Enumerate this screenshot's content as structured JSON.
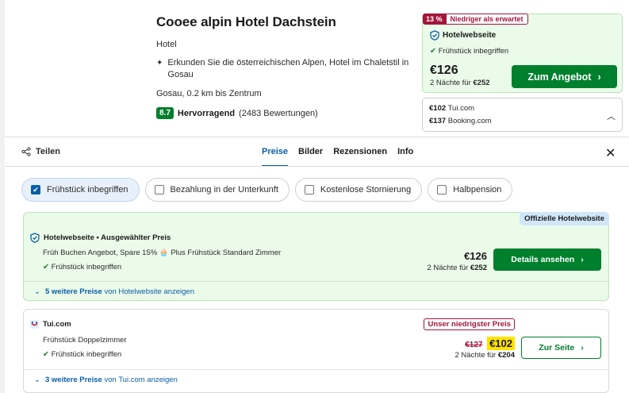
{
  "hotel": {
    "name": "Cooee alpin Hotel Dachstein",
    "type": "Hotel",
    "description": "Erkunden Sie die österreichischen Alpen, Hotel im Chaletstil in Gosau",
    "distance": "Gosau, 0.2 km bis Zentrum",
    "score": "8.7",
    "rating_label": "Hervorragend",
    "rating_count": "(2483 Bewertungen)"
  },
  "top_offer": {
    "discount": "13 %",
    "discount_text": "Niedriger als erwartet",
    "site": "Hotelwebseite",
    "breakfast": "Frühstück inbegriffen",
    "price": "€126",
    "nights_prefix": "2 Nächte für",
    "nights_total": "€252",
    "button": "Zum Angebot"
  },
  "alternatives": [
    {
      "price": "€102",
      "site": "Tui.com"
    },
    {
      "price": "€137",
      "site": "Booking.com"
    }
  ],
  "share_label": "Teilen",
  "tabs": [
    {
      "label": "Preise",
      "active": true
    },
    {
      "label": "Bilder",
      "active": false
    },
    {
      "label": "Rezensionen",
      "active": false
    },
    {
      "label": "Info",
      "active": false
    }
  ],
  "filters": [
    {
      "label": "Frühstück inbegriffen",
      "checked": true
    },
    {
      "label": "Bezahlung in der Unterkunft",
      "checked": false
    },
    {
      "label": "Kostenlose Stornierung",
      "checked": false
    },
    {
      "label": "Halbpension",
      "checked": false
    }
  ],
  "deals": [
    {
      "tag": "Offizielle Hotelwebsite",
      "title": "Hotelwebseite • Ausgewählter Preis",
      "line": "Früh Buchen Angebot, Spare 15%",
      "line_extra": "Plus Frühstück Standard Zimmer",
      "breakfast": "Frühstück inbegriffen",
      "price": "€126",
      "nights_prefix": "2 Nächte für",
      "nights_total": "€252",
      "button": "Details ansehen",
      "more_count": "5 weitere Preise",
      "more_suffix": "von Hotelwebsite anzeigen"
    },
    {
      "title": "Tui.com",
      "badge": "Unser niedrigster Preis",
      "line": "Frühstück Doppelzimmer",
      "breakfast": "Frühstück inbegriffen",
      "old_price": "€127",
      "price": "€102",
      "nights_prefix": "2 Nächte für",
      "nights_total": "€204",
      "button": "Zur Seite",
      "more_count": "3 weitere Preise",
      "more_suffix": "von Tui.com anzeigen"
    }
  ],
  "colors": {
    "green": "#007f2d",
    "blue": "#0a5ea8",
    "red": "#a3153a",
    "highlight": "#ffe200",
    "card_bg": "#ebfbe9"
  }
}
